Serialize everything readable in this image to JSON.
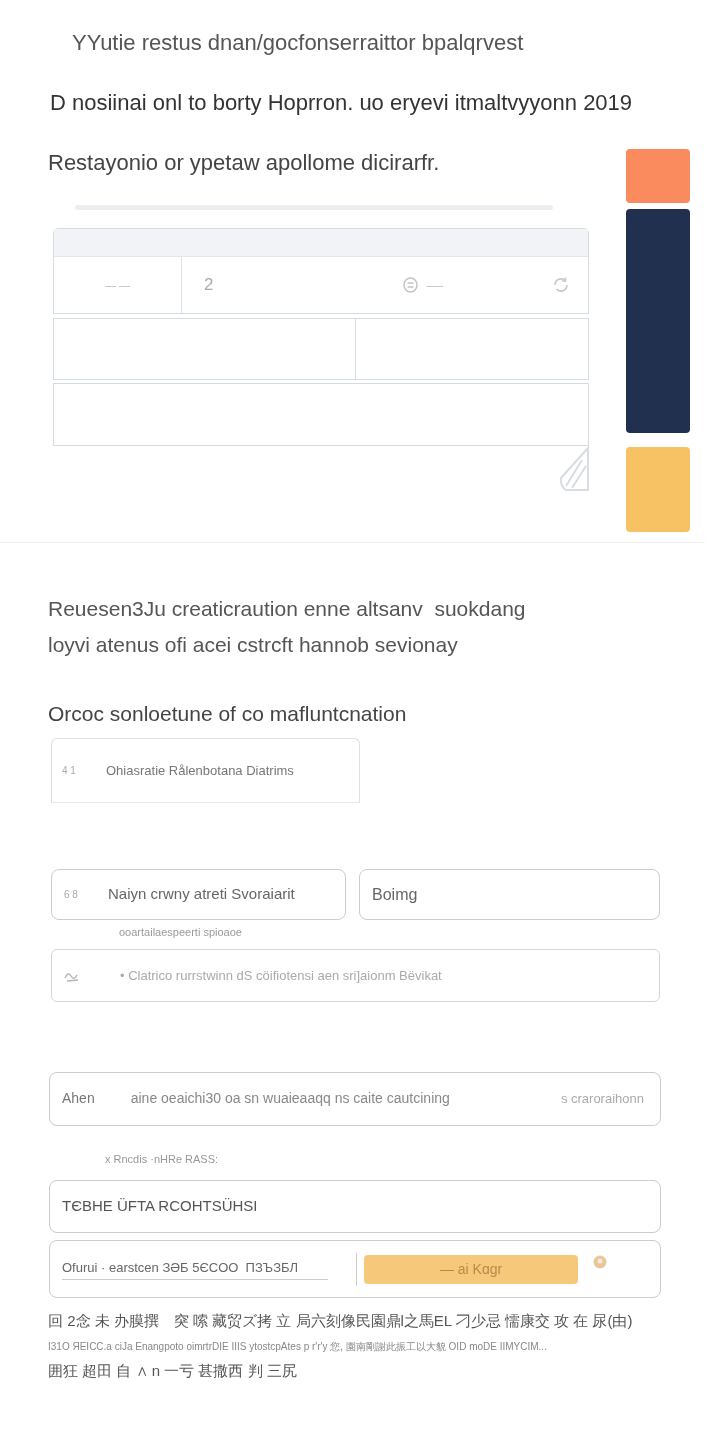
{
  "header": {
    "title": "YYutie restus dnan/gocfonserraittor bpalqrvest",
    "subtitle": "D nosiinai onl to borty Hoprron. uo eryevi itmaltvyyonn 2019"
  },
  "panel": {
    "heading": "Restayonio or ypetaw apollome dicirarfr.",
    "row_1": {
      "cell_1": "–– ––",
      "cell_2": "2",
      "cell_3": "–––"
    }
  },
  "tiles": [
    {
      "color": "#fa8b5f"
    },
    {
      "color": "#22304f"
    },
    {
      "color": "#f6c263"
    }
  ],
  "section": {
    "paragraph": "Reuesen3Ju creaticraution enne altsanv  suokdang loyvi atenus ofi acei cstrcft hannob sevionay",
    "heading": "Orcoc sonloetune of co mafluntcnation",
    "list_item": {
      "number": "4 1",
      "text": "Ohiasratie Rålenbotana Diatrims"
    }
  },
  "fields": [
    {
      "number": "6 8",
      "value": "Naiyn crwny atreti Svoraiarit",
      "helper": "ooartailaespeerti spioaoe"
    },
    {
      "value": "Boimg"
    }
  ],
  "wide_field": {
    "placeholder": "• Clatrico rurrstwinn dS cöifiotensi aen sri]aionm Bëvikat"
  },
  "form": {
    "row": {
      "label": "Ahen",
      "text": "aine oeaichi30 oa sn wuaieaaqq ns caite cautcining",
      "hint": "s craroraihonn"
    },
    "note": "x Rncdis ·nHRe RASS:",
    "code_value": "TЄBHE ÜFTA RCOHTSÜHSI",
    "input_value": "Ofurui · earstcen ЗӘБ 5ЄCOO  ΠЗЪЗБЛ",
    "button": "— ai Kɑgr"
  },
  "footer": [
    "回 2念 未 办膜撰　突 嗦 藏贸ズ拷 立 局六刻像民園鼎l之馬EL 刁少忌 懦康交 攻 在 尿(由)",
    "I31O ЯEICC.a ciJa Enangpoto oimrtrDIE IIIS ytostcpAtes p r'r'y 您, 園南剛謝此振工以大貌 OID  moDE IIMYCIM...",
    "囲狂 超田 自 ∧ n 一亏 甚撒西 判 三尻"
  ]
}
